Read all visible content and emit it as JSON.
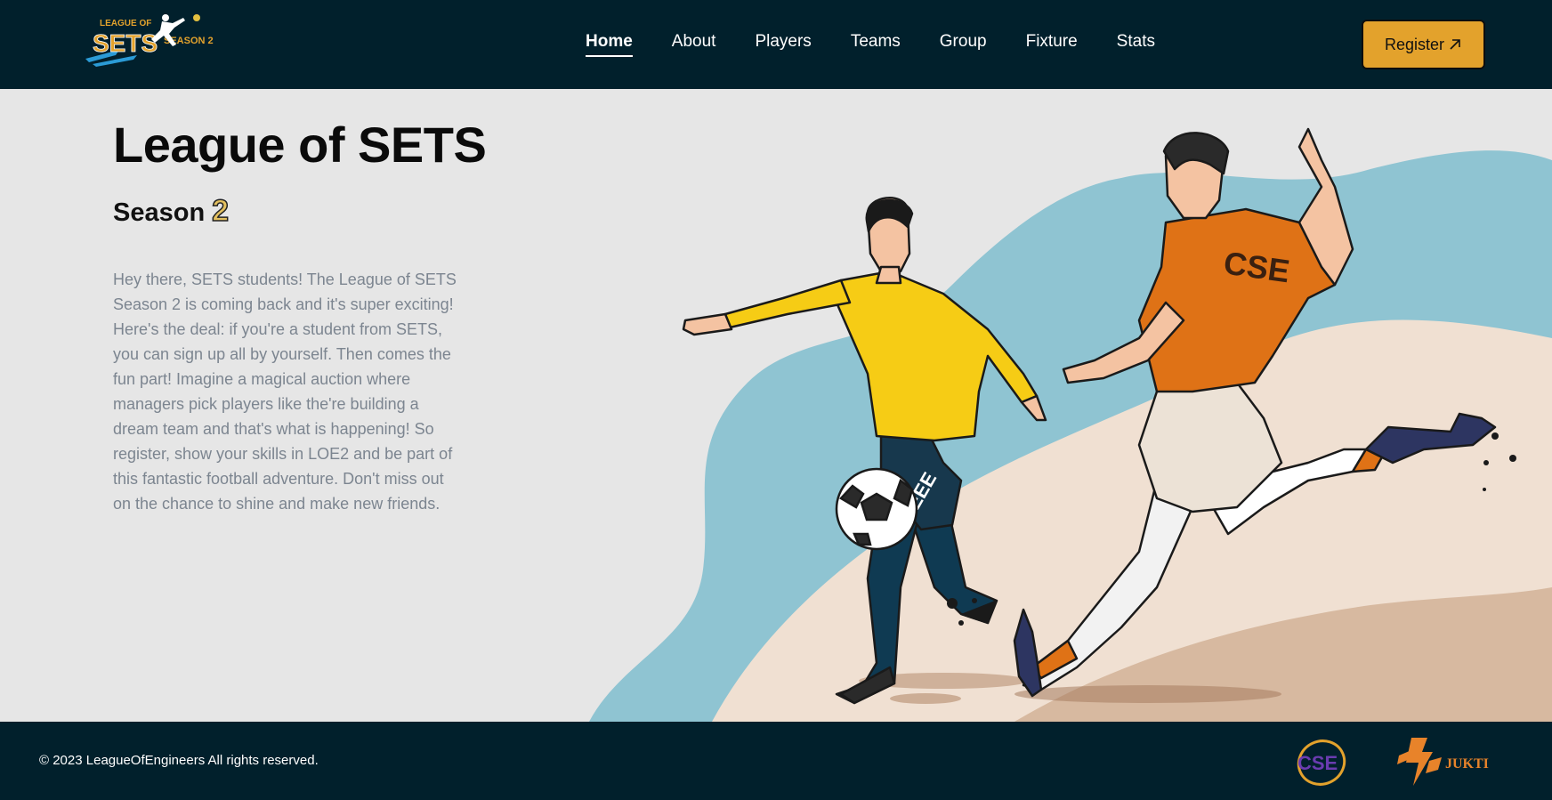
{
  "header": {
    "logo": {
      "line1": "LEAGUE OF",
      "line2": "SETS",
      "line3": "SEASON 2"
    },
    "nav": [
      {
        "label": "Home",
        "active": true
      },
      {
        "label": "About",
        "active": false
      },
      {
        "label": "Players",
        "active": false
      },
      {
        "label": "Teams",
        "active": false
      },
      {
        "label": "Group",
        "active": false
      },
      {
        "label": "Fixture",
        "active": false
      },
      {
        "label": "Stats",
        "active": false
      }
    ],
    "register_label": "Register",
    "register_icon": "arrow-up-right-icon"
  },
  "hero": {
    "title": "League of SETS",
    "subtitle_word": "Season",
    "subtitle_number": "2",
    "description": "Hey there, SETS students! The League of SETS Season 2 is coming back and it's super exciting! Here's the deal: if you're a student from SETS, you can sign up all by yourself. Then comes the fun part! Imagine a magical auction where managers pick players like the're building a dream team and that's what is happening! So register, show your skills in LOE2 and be part of this fantastic football adventure. Don't miss out on the chance to shine and make new friends.",
    "illustration": {
      "player1_jersey": "EEE",
      "player2_jersey": "CSE"
    }
  },
  "footer": {
    "copyright": "© 2023 LeagueOfEngineers All rights reserved.",
    "logo_cse": "CSE",
    "logo_jukti": "JUKTI"
  },
  "colors": {
    "dark_bg": "#01202c",
    "accent": "#e3a22c",
    "hero_bg": "#e6e6e6",
    "text_muted": "#7c8590",
    "blob_blue": "#8fc4d2",
    "blob_sand": "#f0e0d2",
    "jersey_yellow": "#f6cc15",
    "jersey_orange": "#df7216"
  }
}
